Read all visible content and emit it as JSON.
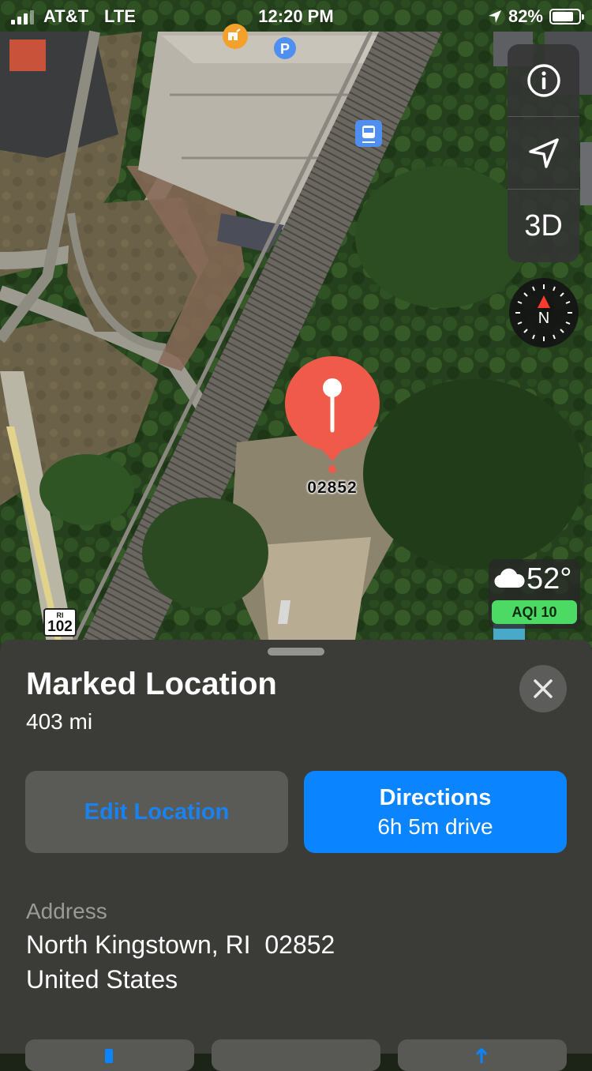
{
  "status_bar": {
    "carrier": "AT&T",
    "network": "LTE",
    "time": "12:20 PM",
    "battery": "82%",
    "battery_level": 0.82
  },
  "map": {
    "controls": {
      "info_icon": "info-icon",
      "location_icon": "location-arrow-icon",
      "view_mode_label": "3D"
    },
    "compass_label": "N",
    "pin_label": "02852",
    "route_shield": {
      "state": "RI",
      "number": "102"
    },
    "weather": {
      "icon": "cloud-icon",
      "temperature": "52°",
      "aqi": "AQI 10"
    },
    "poi_icons": [
      "dog-park-icon",
      "parking-icon",
      "train-station-icon"
    ]
  },
  "sheet": {
    "title": "Marked Location",
    "distance": "403 mi",
    "edit_button": "Edit Location",
    "directions_button": {
      "label": "Directions",
      "sublabel": "6h 5m drive"
    },
    "address_label": "Address",
    "address_line1": "North Kingstown, RI  02852",
    "address_line2": "United States"
  },
  "colors": {
    "pin": "#f05a4a",
    "accent_blue": "#0a84ff",
    "aqi_green": "#4cd964"
  }
}
